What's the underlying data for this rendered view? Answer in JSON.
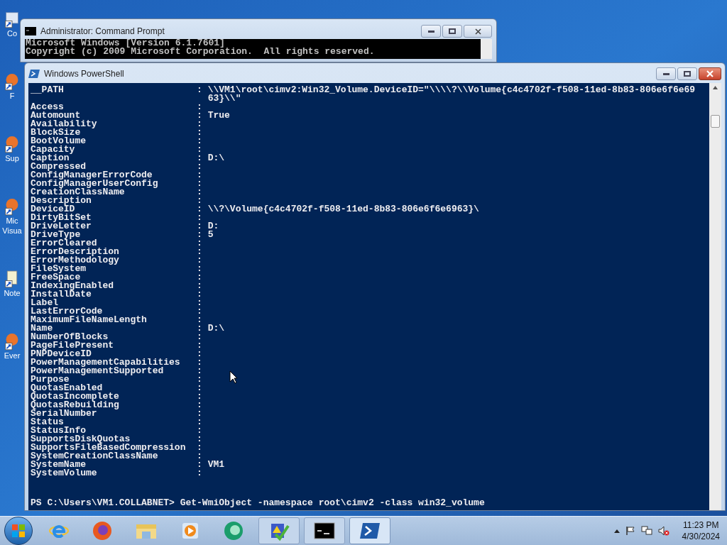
{
  "desktop_icons": [
    {
      "kind": "computer",
      "label": [
        "Co"
      ]
    },
    {
      "kind": "shortcut",
      "label": [
        "F"
      ]
    },
    {
      "kind": "shortcut",
      "label": [
        "Sup"
      ]
    },
    {
      "kind": "shortcut",
      "label": [
        "Mic",
        "Visua"
      ]
    },
    {
      "kind": "notepad",
      "label": [
        "Note"
      ]
    },
    {
      "kind": "shortcut",
      "label": [
        "Ever"
      ]
    }
  ],
  "command_prompt": {
    "title": "Administrator: Command Prompt",
    "lines": [
      "Microsoft Windows [Version 6.1.7601]",
      "Copyright (c) 2009 Microsoft Corporation.  All rights reserved."
    ]
  },
  "powershell": {
    "title": "Windows PowerShell",
    "rows": [
      {
        "name": "__PATH",
        "value": "\\\\VM1\\root\\cimv2:Win32_Volume.DeviceID=\"\\\\\\\\?\\\\Volume{c4c4702f-f508-11ed-8b83-806e6f6e6963}\\\\\""
      },
      {
        "name": "Access",
        "value": ""
      },
      {
        "name": "Automount",
        "value": "True"
      },
      {
        "name": "Availability",
        "value": ""
      },
      {
        "name": "BlockSize",
        "value": ""
      },
      {
        "name": "BootVolume",
        "value": ""
      },
      {
        "name": "Capacity",
        "value": ""
      },
      {
        "name": "Caption",
        "value": "D:\\"
      },
      {
        "name": "Compressed",
        "value": ""
      },
      {
        "name": "ConfigManagerErrorCode",
        "value": ""
      },
      {
        "name": "ConfigManagerUserConfig",
        "value": ""
      },
      {
        "name": "CreationClassName",
        "value": ""
      },
      {
        "name": "Description",
        "value": ""
      },
      {
        "name": "DeviceID",
        "value": "\\\\?\\Volume{c4c4702f-f508-11ed-8b83-806e6f6e6963}\\"
      },
      {
        "name": "DirtyBitSet",
        "value": ""
      },
      {
        "name": "DriveLetter",
        "value": "D:"
      },
      {
        "name": "DriveType",
        "value": "5"
      },
      {
        "name": "ErrorCleared",
        "value": ""
      },
      {
        "name": "ErrorDescription",
        "value": ""
      },
      {
        "name": "ErrorMethodology",
        "value": ""
      },
      {
        "name": "FileSystem",
        "value": ""
      },
      {
        "name": "FreeSpace",
        "value": ""
      },
      {
        "name": "IndexingEnabled",
        "value": ""
      },
      {
        "name": "InstallDate",
        "value": ""
      },
      {
        "name": "Label",
        "value": ""
      },
      {
        "name": "LastErrorCode",
        "value": ""
      },
      {
        "name": "MaximumFileNameLength",
        "value": ""
      },
      {
        "name": "Name",
        "value": "D:\\"
      },
      {
        "name": "NumberOfBlocks",
        "value": ""
      },
      {
        "name": "PageFilePresent",
        "value": ""
      },
      {
        "name": "PNPDeviceID",
        "value": ""
      },
      {
        "name": "PowerManagementCapabilities",
        "value": ""
      },
      {
        "name": "PowerManagementSupported",
        "value": ""
      },
      {
        "name": "Purpose",
        "value": ""
      },
      {
        "name": "QuotasEnabled",
        "value": ""
      },
      {
        "name": "QuotasIncomplete",
        "value": ""
      },
      {
        "name": "QuotasRebuilding",
        "value": ""
      },
      {
        "name": "SerialNumber",
        "value": ""
      },
      {
        "name": "Status",
        "value": ""
      },
      {
        "name": "StatusInfo",
        "value": ""
      },
      {
        "name": "SupportsDiskQuotas",
        "value": ""
      },
      {
        "name": "SupportsFileBasedCompression",
        "value": ""
      },
      {
        "name": "SystemCreationClassName",
        "value": ""
      },
      {
        "name": "SystemName",
        "value": "VM1"
      },
      {
        "name": "SystemVolume",
        "value": ""
      }
    ],
    "separator": ":",
    "prompt": "PS C:\\Users\\VM1.COLLABNET> Get-WmiObject -namespace root\\cimv2 -class win32_volume"
  },
  "taskbar": {
    "pinned": [
      {
        "kind": "ie"
      },
      {
        "kind": "firefox"
      },
      {
        "kind": "folder"
      },
      {
        "kind": "media"
      },
      {
        "kind": "green"
      }
    ],
    "running": [
      {
        "kind": "check",
        "selected": false
      },
      {
        "kind": "cmd",
        "selected": false
      },
      {
        "kind": "powershell",
        "selected": true
      }
    ],
    "clock": {
      "time": "11:23 PM",
      "date": "4/30/2024"
    }
  }
}
